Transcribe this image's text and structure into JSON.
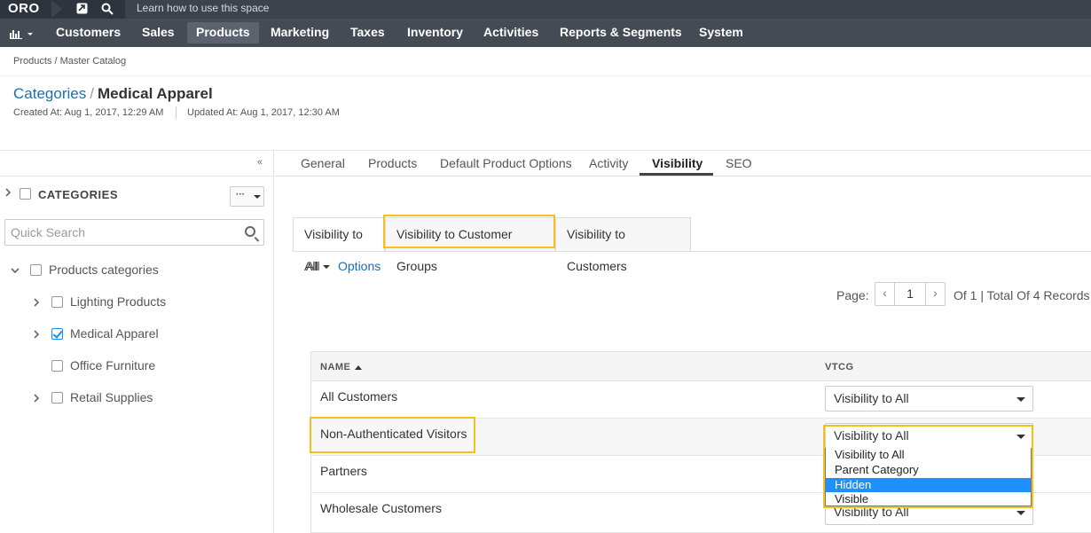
{
  "topbar": {
    "logo": "ORO",
    "learn": "Learn how to use this space"
  },
  "nav": {
    "items": [
      "Customers",
      "Sales",
      "Products",
      "Marketing",
      "Taxes",
      "Inventory",
      "Activities",
      "Reports & Segments",
      "System"
    ],
    "active": "Products"
  },
  "breadcrumb": "Products / Master Catalog",
  "title": {
    "parent": "Categories",
    "separator": "/",
    "current": "Medical Apparel"
  },
  "meta": {
    "created": "Created At: Aug 1, 2017, 12:29 AM",
    "updated": "Updated At: Aug 1, 2017, 12:30 AM"
  },
  "sidebar": {
    "collapse_glyph": "«",
    "root_label": "CATEGORIES",
    "actions_dots": "···",
    "search_placeholder": "Quick Search",
    "tree": {
      "root": "Products categories",
      "children": [
        {
          "label": "Lighting Products",
          "checked": false,
          "expandable": true
        },
        {
          "label": "Medical Apparel",
          "checked": true,
          "expandable": true
        },
        {
          "label": "Office Furniture",
          "checked": false,
          "expandable": false
        },
        {
          "label": "Retail Supplies",
          "checked": false,
          "expandable": true
        }
      ]
    }
  },
  "tabs": [
    "General",
    "Products",
    "Default Product Options",
    "Activity",
    "Visibility",
    "SEO"
  ],
  "active_tab": "Visibility",
  "subtabs": [
    "Visibility to All",
    "Visibility to Customer Groups",
    "Visibility to Customers"
  ],
  "active_subtab": "Visibility to All",
  "filter": {
    "all": "All",
    "options": "Options"
  },
  "pager": {
    "label": "Page:",
    "prev": "‹",
    "next": "›",
    "current": "1",
    "info": "Of 1 |  Total Of 4 Records"
  },
  "grid": {
    "columns": [
      "NAME",
      "VTCG"
    ],
    "rows": [
      {
        "name": "All Customers",
        "value": "Visibility to All"
      },
      {
        "name": "Non-Authenticated Visitors",
        "value": "Visibility to All"
      },
      {
        "name": "Partners",
        "value": ""
      },
      {
        "name": "Wholesale Customers",
        "value": "Visibility to All"
      }
    ]
  },
  "dropdown": {
    "options": [
      "Visibility to All",
      "Parent Category",
      "Hidden",
      "Visible"
    ],
    "highlighted": "Hidden"
  },
  "colors": {
    "highlight": "#f3c11c",
    "link": "#1f6fa8",
    "nav_bg": "#454b55",
    "selected_option": "#1e90ff"
  }
}
